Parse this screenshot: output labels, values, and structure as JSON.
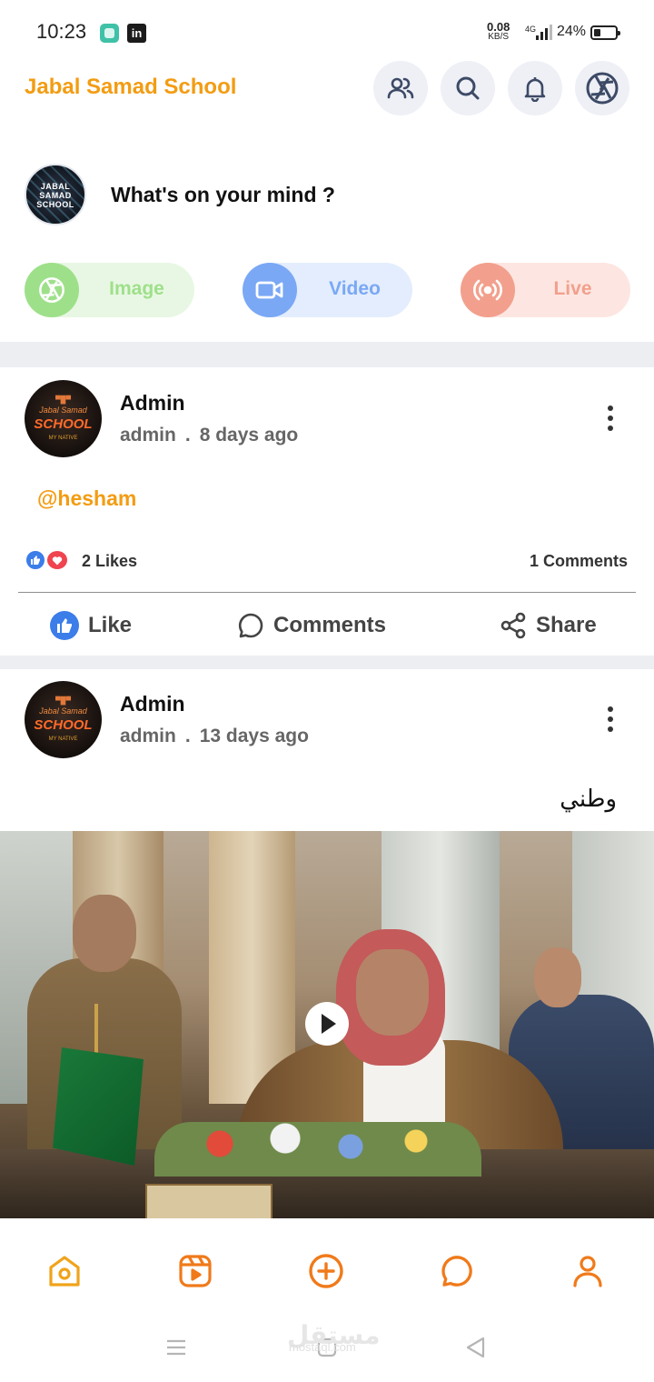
{
  "status": {
    "time": "10:23",
    "network_speed": "0.08",
    "network_unit": "KB/S",
    "network_type": "4G",
    "battery": "24%",
    "app_icon_2": "in"
  },
  "header": {
    "brand": "Jabal Samad School",
    "icons": [
      "friends-icon",
      "search-icon",
      "bell-icon",
      "camera-aperture-icon"
    ]
  },
  "composer": {
    "avatar_text": "JABAL SAMAD SCHOOL",
    "prompt": "What's on your mind ?",
    "buttons": [
      {
        "label": "Image",
        "icon": "aperture-icon",
        "color": "#9ee08a"
      },
      {
        "label": "Video",
        "icon": "video-camera-icon",
        "color": "#7aa8f5"
      },
      {
        "label": "Live",
        "icon": "broadcast-icon",
        "color": "#f2a08d"
      }
    ]
  },
  "posts": [
    {
      "author": "Admin",
      "username": "admin",
      "sep": ".",
      "time": "8 days ago",
      "avatar": {
        "line1": "Jabal Samad",
        "line2": "SCHOOL",
        "line3": "MY NATIVE"
      },
      "body": "@hesham",
      "likes": "2 Likes",
      "comments": "1 Comments",
      "actions": {
        "like": "Like",
        "comments": "Comments",
        "share": "Share"
      }
    },
    {
      "author": "Admin",
      "username": "admin",
      "sep": ".",
      "time": "13 days ago",
      "avatar": {
        "line1": "Jabal Samad",
        "line2": "SCHOOL",
        "line3": "MY NATIVE"
      },
      "body": "وطني",
      "has_video": true
    }
  ],
  "bottom_nav": [
    "home-icon",
    "reels-icon",
    "add-icon",
    "chat-icon",
    "profile-icon"
  ],
  "watermark": {
    "arabic": "مستقل",
    "latin": "mostaql.com"
  },
  "colors": {
    "accent": "#f39c12",
    "nav": "#f07a1a",
    "like_blue": "#3b7de9",
    "love_red": "#f0444f"
  }
}
